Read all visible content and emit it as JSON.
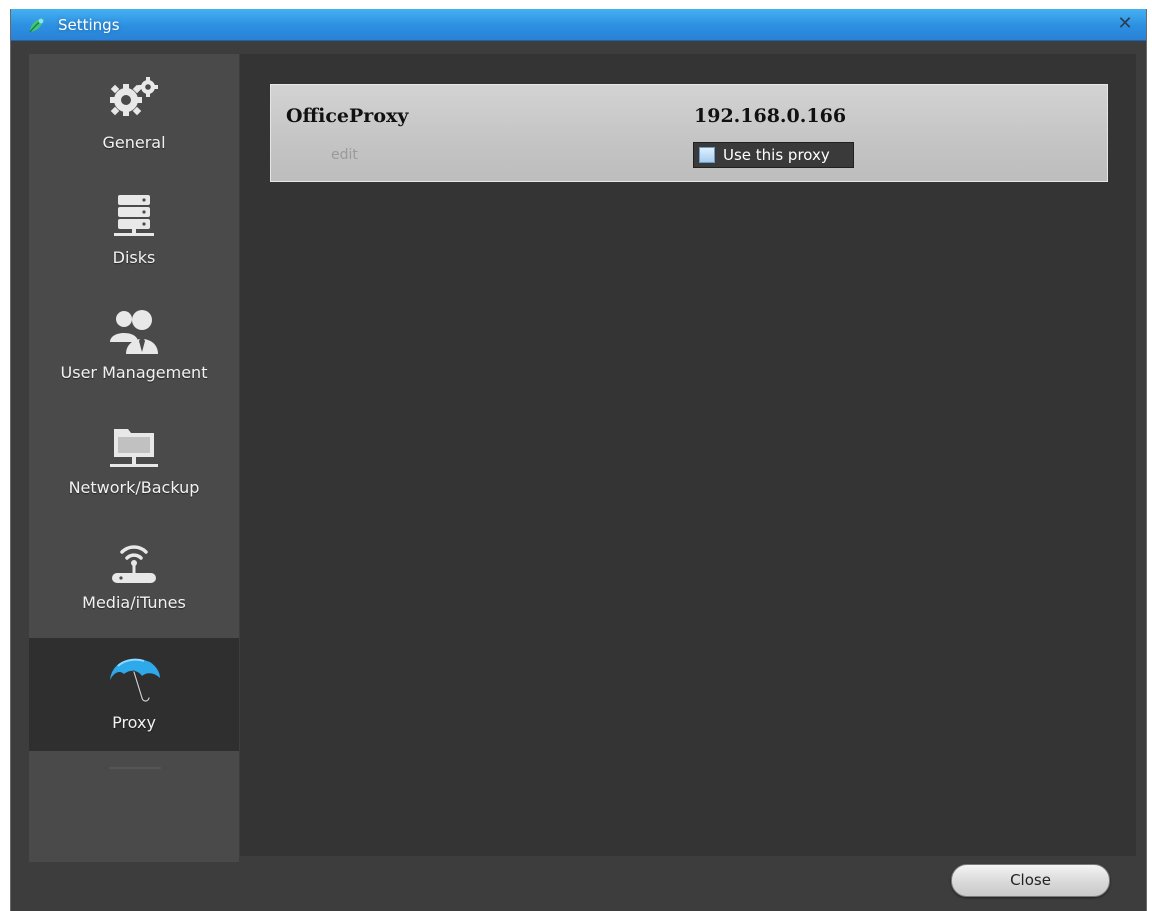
{
  "window": {
    "title": "Settings",
    "close_glyph": "✕"
  },
  "sidebar": {
    "items": [
      {
        "label": "General",
        "icon": "gears-icon"
      },
      {
        "label": "Disks",
        "icon": "server-stack-icon"
      },
      {
        "label": "User Management",
        "icon": "users-icon"
      },
      {
        "label": "Network/Backup",
        "icon": "network-folder-icon"
      },
      {
        "label": "Media/iTunes",
        "icon": "wireless-router-icon"
      },
      {
        "label": "Proxy",
        "icon": "umbrella-icon",
        "selected": true
      }
    ]
  },
  "proxies": [
    {
      "name": "OfficeProxy",
      "address": "192.168.0.166",
      "edit_label": "edit",
      "use_label": "Use this proxy",
      "use_checked": false
    }
  ],
  "footer": {
    "close_label": "Close"
  },
  "colors": {
    "titlebar": "#2c8fe1",
    "umbrella": "#2ea9ea",
    "background": "#3d3d3d"
  }
}
